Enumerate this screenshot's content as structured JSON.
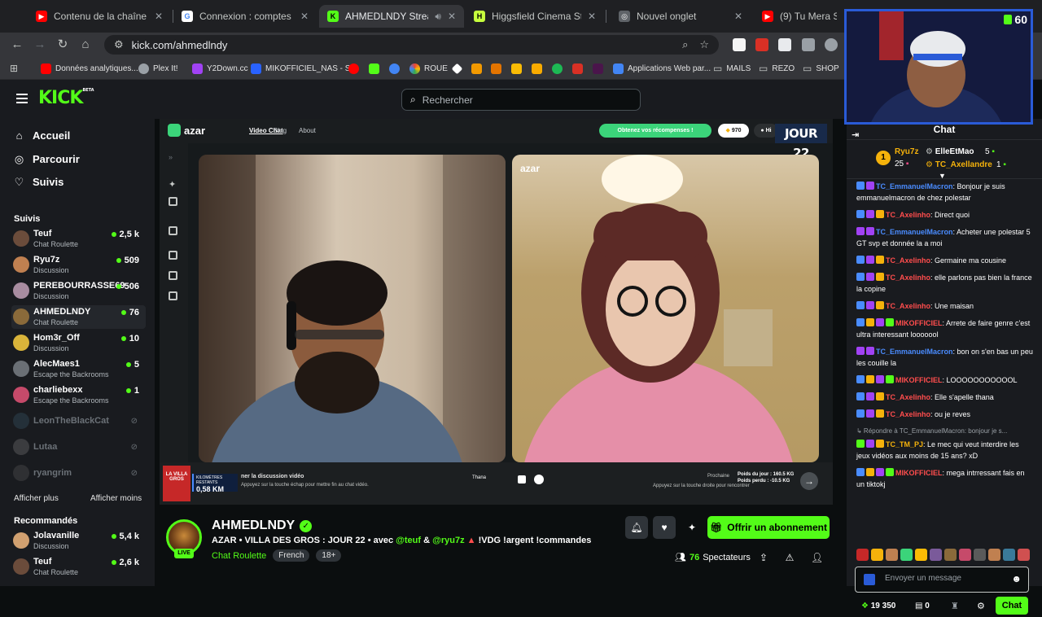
{
  "browser": {
    "tabs": [
      {
        "title": "Contenu de la chaîne - YouTube",
        "color": "#ff0000",
        "glyph": "▶"
      },
      {
        "title": "Connexion : comptes Google",
        "color": "#4285f4",
        "glyph": "G"
      },
      {
        "title": "AHMEDLNDY Stream - Watc",
        "color": "#53fc18",
        "glyph": "K"
      },
      {
        "title": "Higgsfield Cinema Studio | Profe",
        "color": "#c6ff3d",
        "glyph": "H"
      },
      {
        "title": "Nouvel onglet",
        "color": "#8ab4f8",
        "glyph": "◎"
      },
      {
        "title": "(9) Tu Mera Superman",
        "color": "#ff0000",
        "glyph": "▶"
      }
    ],
    "url": "kick.com/ahmedlndy",
    "bookmarks": [
      {
        "label": "Données analytiques...",
        "color": "#ff0000"
      },
      {
        "label": "Plex It!",
        "color": "#9aa0a6"
      },
      {
        "label": "Y2Down.cc",
        "color": "#a142f4"
      },
      {
        "label": "MIKOFFICIEL_NAS - S...",
        "color": "#2962ff"
      },
      {
        "label": "ROUE",
        "color": "#e8eaed"
      },
      {
        "label": "Applications Web par...",
        "color": "#4285f4"
      },
      {
        "label": "MAILS",
        "color": "#9aa0a6"
      },
      {
        "label": "REZO",
        "color": "#9aa0a6"
      },
      {
        "label": "SHOP",
        "color": "#9aa0a6"
      }
    ]
  },
  "kick": {
    "search_placeholder": "Rechercher",
    "logo_beta": "BETA",
    "nav": [
      {
        "label": "Accueil",
        "icon": "home-icon",
        "glyph": "⌂"
      },
      {
        "label": "Parcourir",
        "icon": "compass-icon",
        "glyph": "◎"
      },
      {
        "label": "Suivis",
        "icon": "heart-icon",
        "glyph": "♡"
      }
    ],
    "followed_title": "Suivis",
    "followed": [
      {
        "name": "Teuf",
        "category": "Chat Roulette",
        "viewers": "2,5 k",
        "color": "#6b4c3b"
      },
      {
        "name": "Ryu7z",
        "category": "Discussion",
        "viewers": "509",
        "color": "#c08050"
      },
      {
        "name": "PEREBOURRASSE69",
        "category": "Discussion",
        "viewers": "506",
        "color": "#a88ca0"
      },
      {
        "name": "AHMEDLNDY",
        "category": "Chat Roulette",
        "viewers": "76",
        "color": "#8a6a3a"
      },
      {
        "name": "Hom3r_Off",
        "category": "Discussion",
        "viewers": "10",
        "color": "#d9b43a"
      },
      {
        "name": "AlecMaes1",
        "category": "Escape the Backrooms",
        "viewers": "5",
        "color": "#6a6f75"
      },
      {
        "name": "charliebexx",
        "category": "Escape the Backrooms",
        "viewers": "1",
        "color": "#c64a6a"
      }
    ],
    "offline": [
      {
        "name": "LeonTheBlackCat",
        "color": "#3a5a6a"
      },
      {
        "name": "Lutaa",
        "color": "#7a7a7a"
      },
      {
        "name": "ryangrim",
        "color": "#5a5a5a"
      }
    ],
    "show_more": "Afficher plus",
    "show_less": "Afficher moins",
    "recommended_title": "Recommandés",
    "recommended": [
      {
        "name": "Jolavanille",
        "category": "Discussion",
        "viewers": "5,4 k",
        "color": "#d0a070"
      },
      {
        "name": "Teuf",
        "category": "Chat Roulette",
        "viewers": "2,6 k",
        "color": "#6b4c3b"
      }
    ]
  },
  "video": {
    "azar_logo": "azar",
    "azar_nav": [
      "Video Chat",
      "Blog",
      "About"
    ],
    "reward_pill": "Obtenez vos récompenses !",
    "gems": "970",
    "jour": "JOUR 22",
    "km_label": "KILOMÈTRES RESTANTS",
    "km_value": "0,58 KM",
    "brand_left": "LA VILLA GROS",
    "hint_left": "ner la discussion vidéo",
    "hint_left2": "Appuyez sur la touche échap pour mettre fin au chat vidéo.",
    "hint_right": "Appuyez sur la touche droite pour rencontrer",
    "prochaine": "Prochaine",
    "poids_jour": "Poids du jour : 160.5 KG",
    "poids_perdu": "Poids perdu : -10.5 KG",
    "partner": "Thana",
    "azar_small": "azar"
  },
  "stream": {
    "streamer": "AHMEDLNDY",
    "live": "LIVE",
    "title_prefix": "AZAR • VILLA DES GROS : JOUR 22 • avec",
    "mention1": "@teuf",
    "title_amp": "&",
    "mention2": "@ryu7z",
    "title_suffix": "!VDG !argent !commandes",
    "category": "Chat Roulette",
    "tags": [
      "French",
      "18+"
    ],
    "subscribe_label": "Offrir un abonnement",
    "viewers_count": "76",
    "viewers_label": "Spectateurs"
  },
  "chat": {
    "title": "Chat",
    "top_gifters": [
      {
        "name": "Ryu7z",
        "count": "25",
        "color": "#f5b20b"
      },
      {
        "name": "ElleEtMao",
        "count": "5",
        "color": "#ffffff"
      },
      {
        "name": "TC_Axellandre",
        "count": "1",
        "color": "#f5b20b"
      }
    ],
    "messages": [
      {
        "user": "TC_EmmanuelMacron",
        "color": "#4a8cff",
        "text": ": Bonjour je suis emmanuelmacron de chez polestar"
      },
      {
        "user": "TC_Axelinho",
        "color": "#ff4d4d",
        "text": ": Direct quoi"
      },
      {
        "user": "TC_EmmanuelMacron",
        "color": "#4a8cff",
        "text": ": Acheter une polestar 5 GT svp et donnée la a moi"
      },
      {
        "user": "TC_Axelinho",
        "color": "#ff4d4d",
        "text": ": Germaine ma cousine"
      },
      {
        "user": "TC_Axelinho",
        "color": "#ff4d4d",
        "text": ": elle parlons pas bien la france la copine"
      },
      {
        "user": "TC_Axelinho",
        "color": "#ff4d4d",
        "text": ": Une maisan"
      },
      {
        "user": "MIKOFFICIEL",
        "color": "#ff4d4d",
        "text": ": Arrete de faire genre c'est ultra interessant looooool"
      },
      {
        "user": "TC_EmmanuelMacron",
        "color": "#4a8cff",
        "text": ": bon on s'en bas un peu les couille la"
      },
      {
        "user": "MIKOFFICIEL",
        "color": "#ff4d4d",
        "text": ": LOOOOOOOOOOOL"
      },
      {
        "user": "TC_Axelinho",
        "color": "#ff4d4d",
        "text": ": Elle s'apelle thana"
      },
      {
        "user": "TC_Axelinho",
        "color": "#ff4d4d",
        "text": ": ou je reves"
      },
      {
        "reply": "↳ Répondre à TC_EmmanuelMacron: bonjour je s...",
        "user": "TC_TM_PJ",
        "color": "#f5b20b",
        "text": ": Le mec qui veut interdire les jeux vidéos aux moins de 15 ans? xD"
      },
      {
        "user": "MIKOFFICIEL",
        "color": "#ff4d4d",
        "text": ": mega intrressant fais en un tiktokj"
      }
    ],
    "input_placeholder": "Envoyer un message",
    "points": "19 350",
    "zero": "0",
    "send_label": "Chat"
  },
  "webcam": {
    "badge": "60"
  }
}
